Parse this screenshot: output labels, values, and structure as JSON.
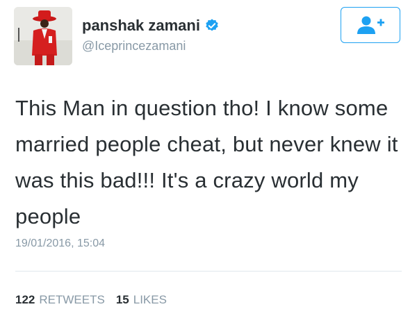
{
  "user": {
    "fullname": "panshak zamani",
    "username": "@Iceprincezamani",
    "verified": true
  },
  "icons": {
    "verified": "verified-badge-icon",
    "follow": "add-user-icon"
  },
  "tweet": {
    "text": "This Man in question tho! I know some married people cheat, but never knew it was this bad!!! It's a crazy world my people",
    "timestamp": "19/01/2016, 15:04"
  },
  "stats": {
    "retweets_count": "122",
    "retweets_label": "RETWEETS",
    "likes_count": "15",
    "likes_label": "LIKES"
  },
  "colors": {
    "accent": "#1da1f2",
    "text": "#292f33",
    "muted": "#8899a6",
    "divider": "#e1e8ed"
  }
}
